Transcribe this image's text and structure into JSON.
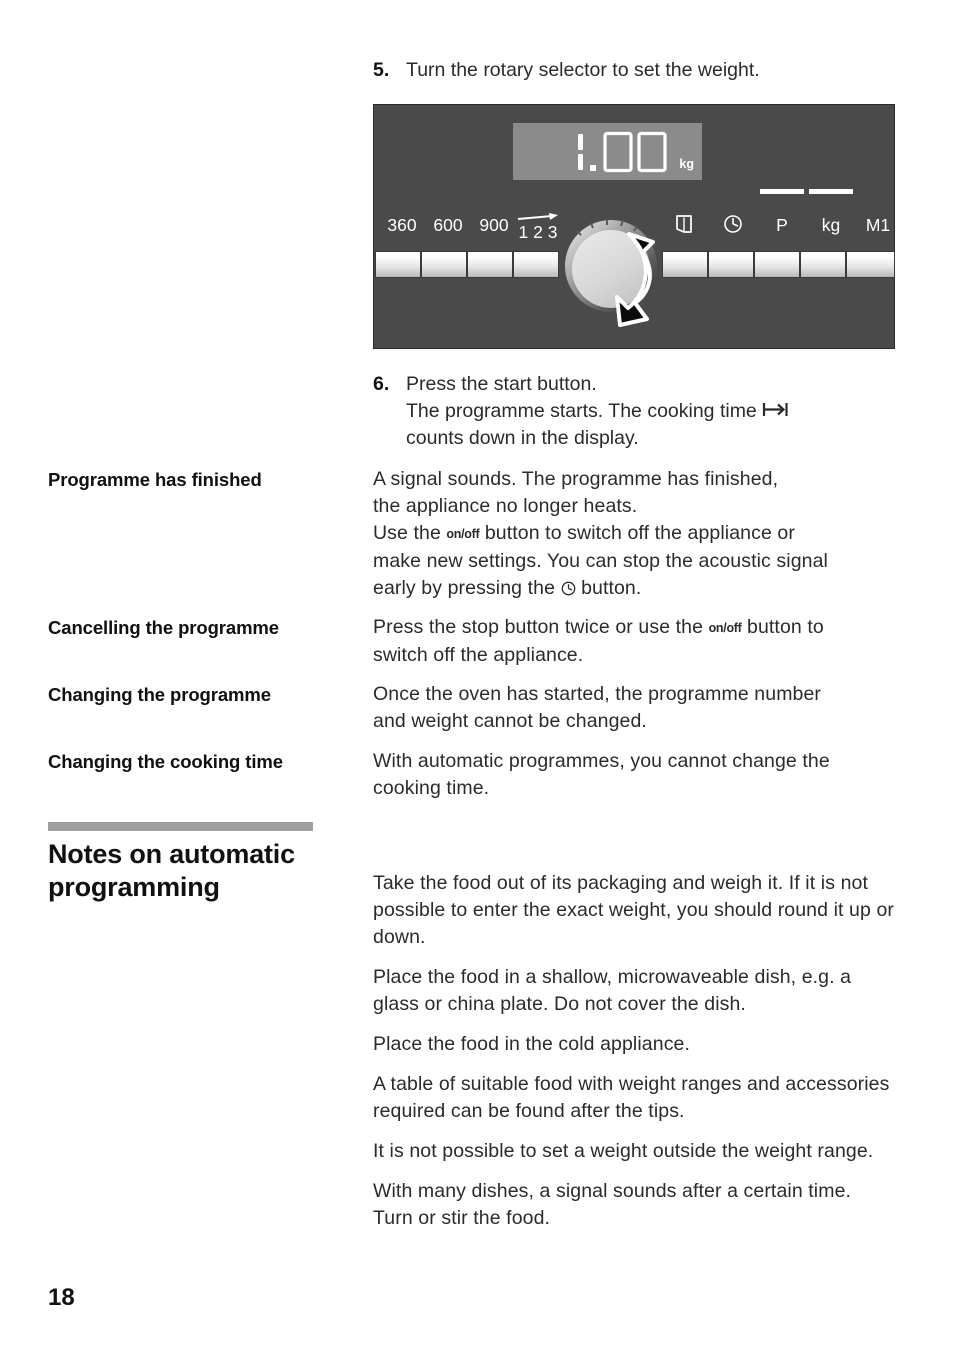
{
  "page": {
    "number": "18"
  },
  "steps": [
    {
      "num": "5.",
      "text": "Turn the rotary selector to set the weight."
    },
    {
      "num": "6.",
      "line1": "Press the start button.",
      "line2_a": "The programme starts. The cooking time ",
      "line2_icon": "cooking-time-icon",
      "line3": "counts down in the display."
    }
  ],
  "control_panel": {
    "display_value": "1.00",
    "display_unit": "kg",
    "left_labels": [
      "360",
      "600",
      "900",
      "1 2 3"
    ],
    "left_label_arrow": "arrow-right-icon",
    "right_labels": [
      "door-icon",
      "clock-icon",
      "P",
      "kg",
      "M1"
    ],
    "indicator_bars": [
      "P",
      "kg"
    ],
    "knob": "rotary-selector",
    "knob_arrow": "clockwise-rotation-arrow"
  },
  "sections": [
    {
      "term": "Programme has finished",
      "lines": [
        {
          "parts": [
            {
              "t": "text",
              "v": "A signal sounds. The programme has finished,"
            }
          ]
        },
        {
          "parts": [
            {
              "t": "text",
              "v": "the appliance no longer heats."
            }
          ]
        },
        {
          "parts": [
            {
              "t": "text",
              "v": "Use the "
            },
            {
              "t": "onoff",
              "v": "on/off"
            },
            {
              "t": "text",
              "v": " button to switch off the appliance or"
            }
          ]
        },
        {
          "parts": [
            {
              "t": "text",
              "v": "make new settings. You can stop the acoustic signal"
            }
          ]
        },
        {
          "parts": [
            {
              "t": "text",
              "v": "early by pressing the "
            },
            {
              "t": "clock",
              "v": ""
            },
            {
              "t": "text",
              "v": " button."
            }
          ]
        }
      ]
    },
    {
      "term": "Cancelling the programme",
      "lines": [
        {
          "parts": [
            {
              "t": "text",
              "v": "Press the stop button twice or use the "
            },
            {
              "t": "onoff",
              "v": "on/off"
            },
            {
              "t": "text",
              "v": " button to"
            }
          ]
        },
        {
          "parts": [
            {
              "t": "text",
              "v": "switch off the appliance."
            }
          ]
        }
      ]
    },
    {
      "term": "Changing the programme",
      "lines": [
        {
          "parts": [
            {
              "t": "text",
              "v": "Once the oven has started, the programme number"
            }
          ]
        },
        {
          "parts": [
            {
              "t": "text",
              "v": "and weight cannot be changed."
            }
          ]
        }
      ]
    },
    {
      "term": "Changing the cooking time",
      "lines": [
        {
          "parts": [
            {
              "t": "text",
              "v": "With automatic programmes, you cannot change the"
            }
          ]
        },
        {
          "parts": [
            {
              "t": "text",
              "v": "cooking time."
            }
          ]
        }
      ]
    }
  ],
  "notes": {
    "heading": "Notes on automatic programming",
    "paragraphs": [
      "Take the food out of its packaging and weigh it. If it is not possible to enter the exact weight, you should round it up or down.",
      "Place the food in a shallow, microwaveable dish, e.g. a glass or china plate. Do not cover the dish.",
      "Place the food in the cold appliance.",
      "A table of suitable food with weight ranges and accessories required can be found after the tips.",
      "It is not possible to set a weight outside the weight range.",
      "With many dishes, a signal sounds after a certain time. Turn or stir the food."
    ]
  },
  "colors": {
    "panel_bg": "#4a4a4a",
    "display_bg": "#8b8b8b",
    "rule": "#a0a0a0",
    "text": "#2b2b2b"
  }
}
